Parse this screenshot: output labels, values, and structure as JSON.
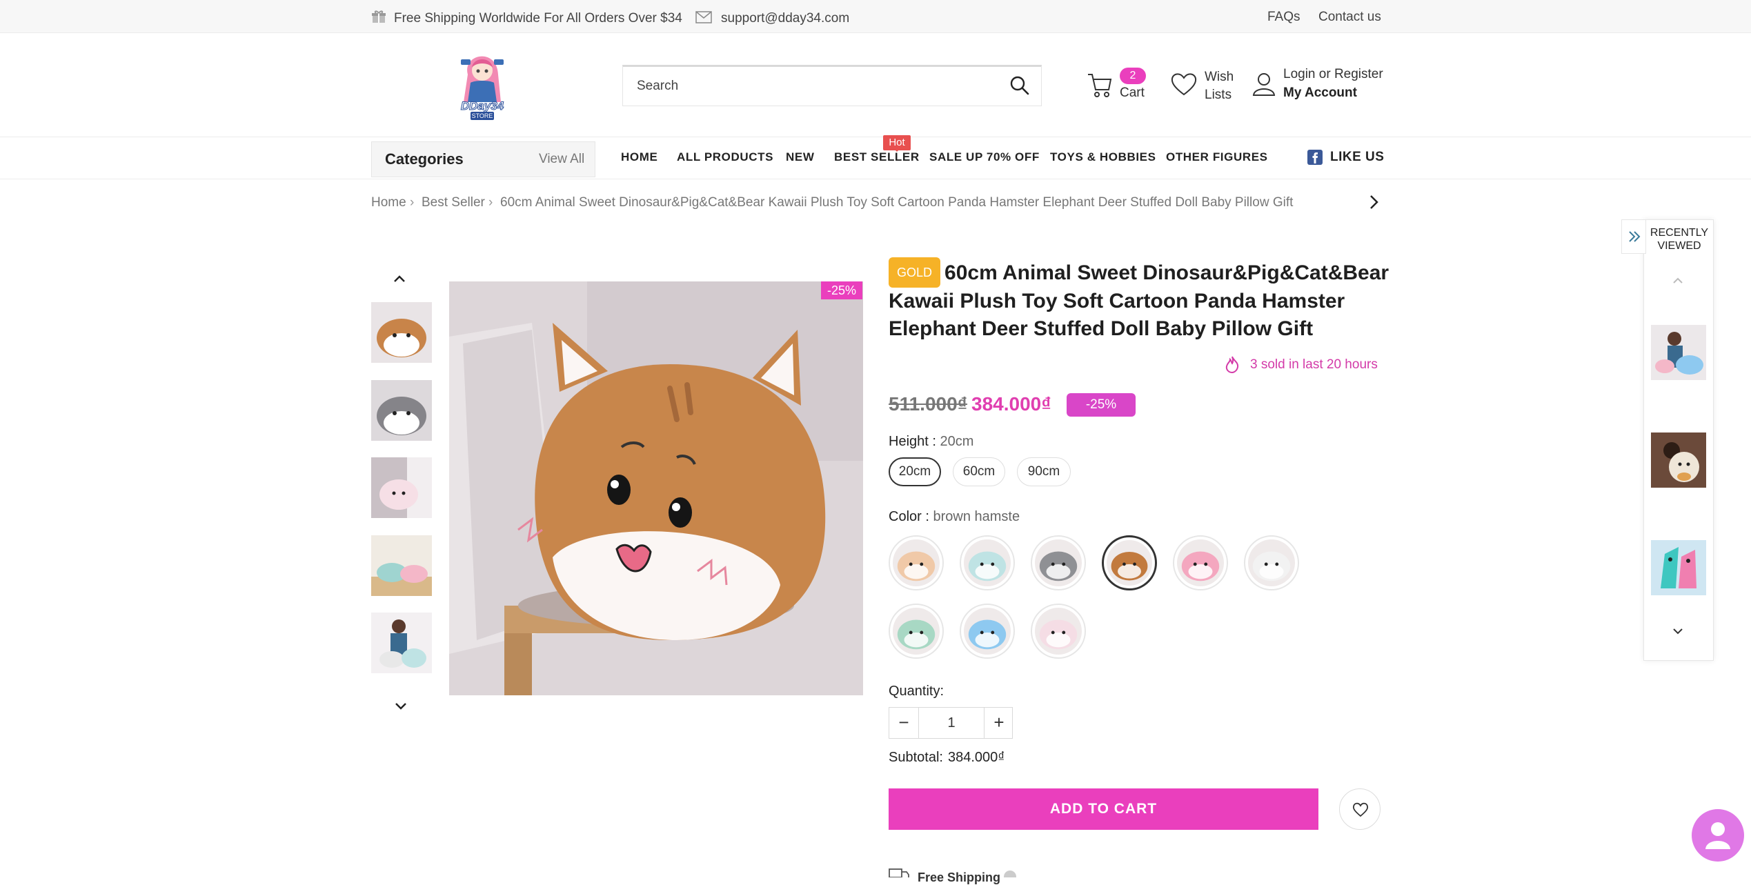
{
  "topbar": {
    "shipping": "Free Shipping Worldwide For All Orders Over $34",
    "email": "support@dday34.com",
    "faqs": "FAQs",
    "contact": "Contact us"
  },
  "header": {
    "logo_text": "DDay34",
    "logo_sub": "STORE",
    "search_placeholder": "Search",
    "cart_count": "2",
    "cart_label": "Cart",
    "wish_line1": "Wish",
    "wish_line2": "Lists",
    "login": "Login or Register",
    "account": "My Account"
  },
  "nav": {
    "categories": "Categories",
    "view_all": "View All",
    "items": [
      "HOME",
      "ALL PRODUCTS",
      "NEW",
      "BEST SELLER",
      "SALE UP 70% OFF",
      "TOYS & HOBBIES",
      "OTHER FIGURES"
    ],
    "hot_badge": "Hot",
    "like_us": "LIKE US"
  },
  "breadcrumb": [
    "Home",
    "Best Seller",
    "60cm Animal Sweet Dinosaur&Pig&Cat&Bear Kawaii Plush Toy Soft Cartoon Panda Hamster Elephant Deer Stuffed Doll Baby Pillow Gift"
  ],
  "product": {
    "gold": "GOLD",
    "title": "60cm Animal Sweet Dinosaur&Pig&Cat&Bear Kawaii Plush Toy Soft Cartoon Panda Hamster Elephant Deer Stuffed Doll Baby Pillow Gift",
    "discount_badge": "-25%",
    "sold": "3 sold in last 20 hours",
    "price_old": "511.000₫",
    "price_new": "384.000₫",
    "price_discount": "-25%",
    "height_label": "Height :",
    "height_value": "20cm",
    "sizes": [
      "20cm",
      "60cm",
      "90cm"
    ],
    "selected_size": "20cm",
    "color_label": "Color :",
    "color_value": "brown hamste",
    "swatch_colors": [
      "#f0c9a8",
      "#bfe3e4",
      "#8f9094",
      "#c27a3e",
      "#f4a7bf",
      "#f2f2f2",
      "#a8d8c4",
      "#8ec9f0",
      "#f5dde5"
    ],
    "selected_swatch": "brown hamste",
    "quantity_label": "Quantity:",
    "quantity": "1",
    "subtotal_label": "Subtotal:",
    "subtotal": "384.000₫",
    "add_to_cart": "ADD TO CART",
    "free_shipping": "Free Shipping"
  },
  "recently_viewed": {
    "title_line1": "RECENTLY",
    "title_line2": "VIEWED"
  },
  "colors": {
    "accent": "#ea3fbd",
    "gold": "#f6b227",
    "hot": "#e8504f"
  }
}
